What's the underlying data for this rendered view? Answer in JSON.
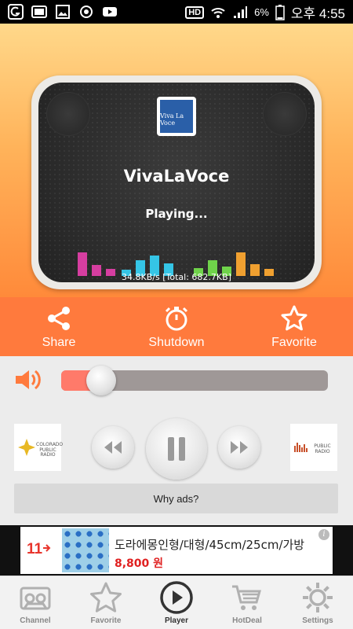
{
  "status_bar": {
    "network": "HD",
    "battery": "6%",
    "time": "오후 4:55"
  },
  "player": {
    "logo_text": "Viva La Voce",
    "station_name": "VivaLaVoce",
    "status": "Playing...",
    "bitrate": "34.8KB/s [Total: 682.7KB]",
    "volume": 0.15
  },
  "actions": [
    {
      "label": "Share",
      "icon": "share-icon"
    },
    {
      "label": "Shutdown",
      "icon": "timer-icon"
    },
    {
      "label": "Favorite",
      "icon": "star-icon"
    }
  ],
  "ad_logos": {
    "left": "COLORADO PUBLIC RADIO",
    "right": "PUBLIC RADIO"
  },
  "why_ads": "Why ads?",
  "banner": {
    "brand": "11",
    "title": "도라에몽인형/대형/45cm/25cm/가방",
    "price": "8,800 원",
    "info": "i"
  },
  "bottom_nav": [
    {
      "label": "Channel",
      "icon": "radio-icon"
    },
    {
      "label": "Favorite",
      "icon": "star-icon"
    },
    {
      "label": "Player",
      "icon": "play-icon",
      "active": true
    },
    {
      "label": "HotDeal",
      "icon": "cart-icon"
    },
    {
      "label": "Settings",
      "icon": "gear-icon"
    }
  ],
  "colors": {
    "accent": "#ff7a3d",
    "slider_fill": "#ff7a6a",
    "banner_price": "#e02020"
  }
}
